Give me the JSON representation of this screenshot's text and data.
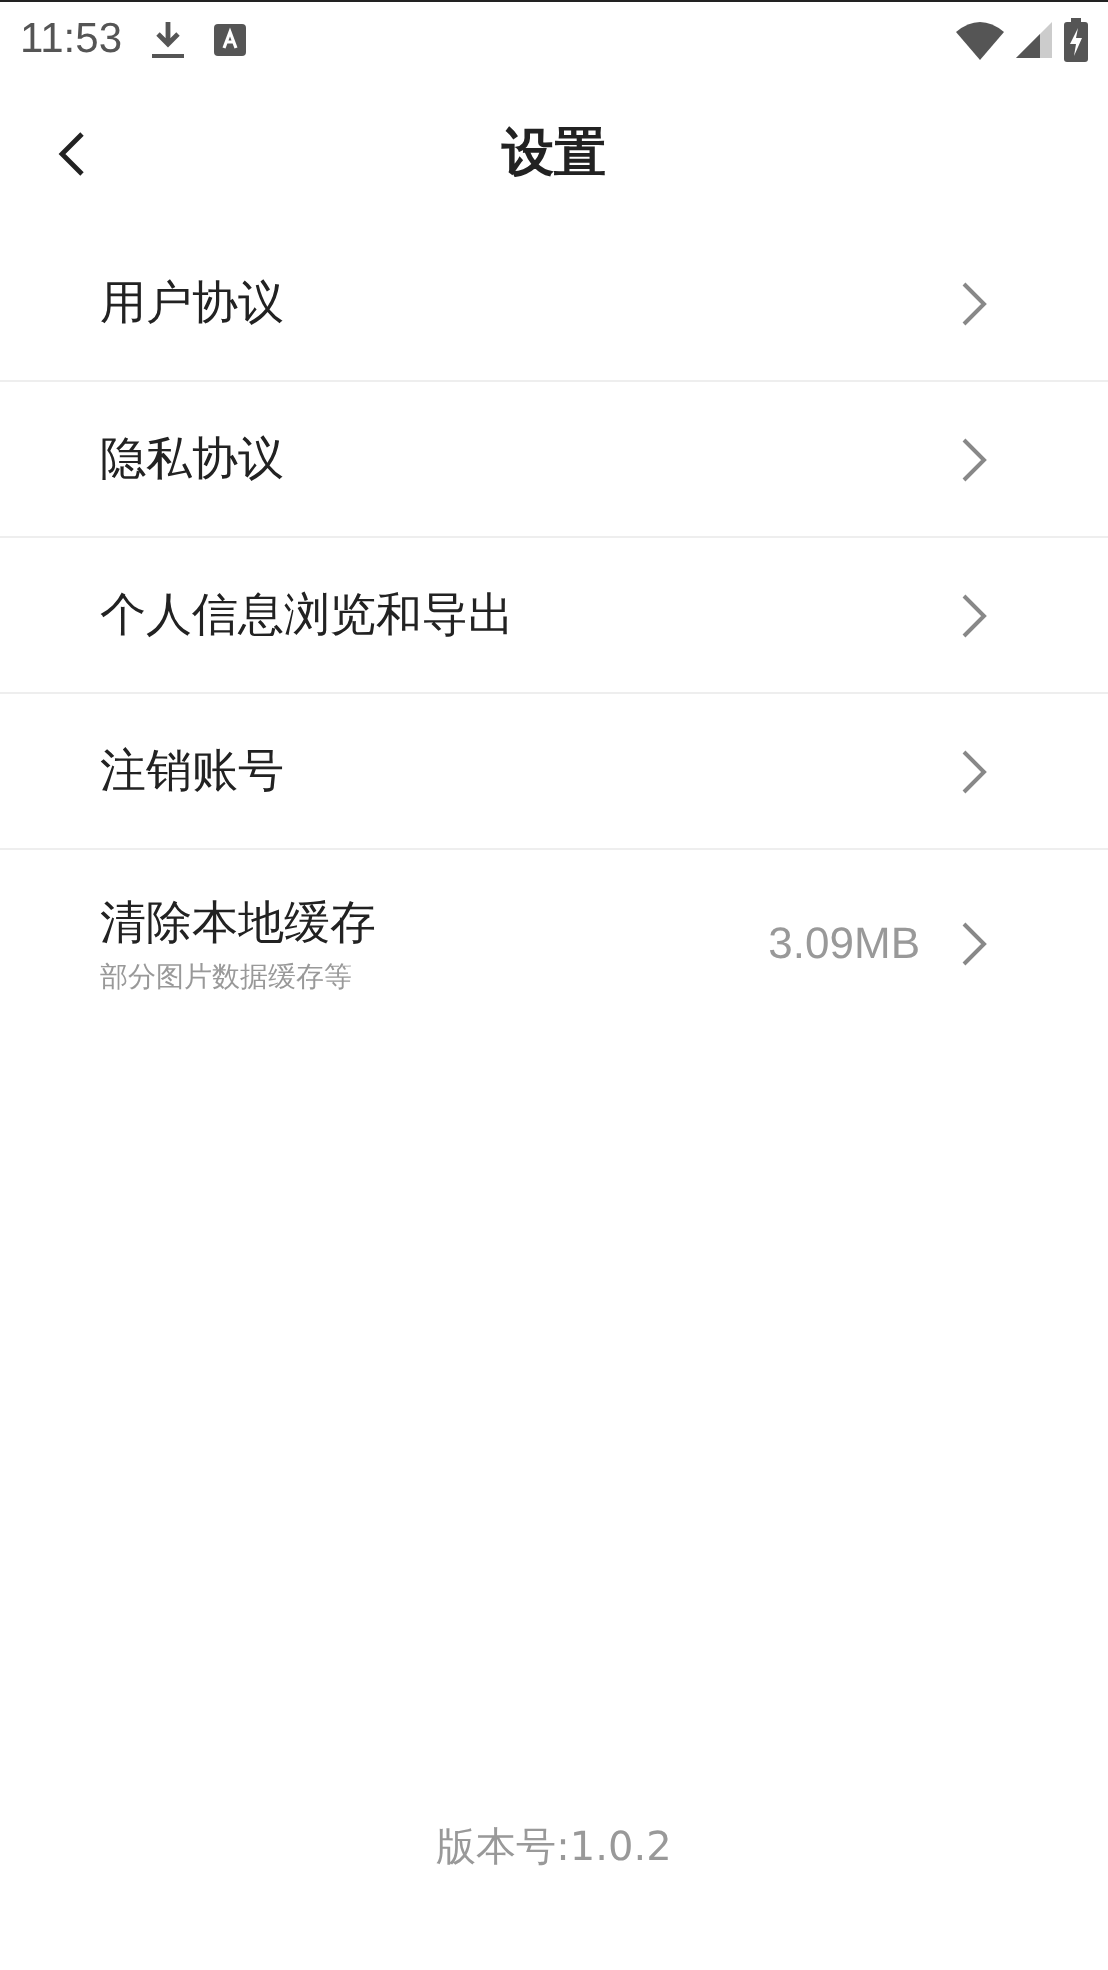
{
  "status_bar": {
    "time": "11:53"
  },
  "header": {
    "title": "设置"
  },
  "items": [
    {
      "label": "用户协议"
    },
    {
      "label": "隐私协议"
    },
    {
      "label": "个人信息浏览和导出"
    },
    {
      "label": "注销账号"
    },
    {
      "label": "清除本地缓存",
      "subtitle": "部分图片数据缓存等",
      "value": "3.09MB"
    }
  ],
  "footer": {
    "version": "版本号:1.0.2"
  }
}
